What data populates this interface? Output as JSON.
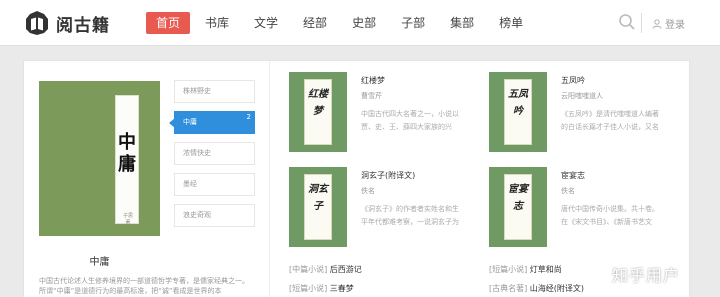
{
  "brand": {
    "name": "阅古籍"
  },
  "nav": [
    {
      "label": "首页",
      "active": true
    },
    {
      "label": "书库"
    },
    {
      "label": "文学"
    },
    {
      "label": "经部"
    },
    {
      "label": "史部"
    },
    {
      "label": "子部"
    },
    {
      "label": "集部"
    },
    {
      "label": "榜单"
    }
  ],
  "header": {
    "login_label": "登录"
  },
  "featured": {
    "cover_title": "中庸",
    "cover_sub": "子思 著",
    "title": "中庸",
    "desc": "中国古代论述人生修养境界的一部道德哲学专著，是儒家经典之一。所谓“中庸”是道德行为的最高标准，把“诚”看成是世界的本"
  },
  "side_list": [
    {
      "label": "株林野史"
    },
    {
      "label": "中庸",
      "active": true,
      "count": "2"
    },
    {
      "label": "浓情快史"
    },
    {
      "label": "墨经"
    },
    {
      "label": "浪史奇观"
    }
  ],
  "books": [
    {
      "cover_text": "红楼梦",
      "title": "红楼梦",
      "author": "曹雪芹",
      "desc": "中国古代四大名著之一，小说以贾、史、王、薛四大家族的兴"
    },
    {
      "cover_text": "五凤吟",
      "title": "五凤吟",
      "author": "云阳嗤嗤道人",
      "desc": "《五凤吟》是清代嗤嗤道人编著的白话长篇才子佳人小说，又名"
    },
    {
      "cover_text": "洞玄子",
      "title": "洞玄子(附译文)",
      "author": "佚名",
      "desc": "《洞玄子》的作者者实姓名和生平年代都难考察，一说洞玄子为"
    },
    {
      "cover_text": "宦宴志",
      "title": "宦宴志",
      "author": "佚名",
      "desc": "唐代中国传奇小说集。共十卷。在《宋文书目》、《新唐书艺文"
    }
  ],
  "small_rows": [
    {
      "cat": "[中篇小说]",
      "title": "后西游记"
    },
    {
      "cat": "[短篇小说]",
      "title": "灯草和尚"
    },
    {
      "cat": "[短篇小说]",
      "title": "三春梦"
    },
    {
      "cat": "[古典名著]",
      "title": "山海经(附译文)"
    }
  ],
  "watermark": "知乎用户",
  "colors": {
    "accent": "#e85a4f",
    "active_blue": "#2f8fdc",
    "cover_green": "#6f9a64"
  }
}
